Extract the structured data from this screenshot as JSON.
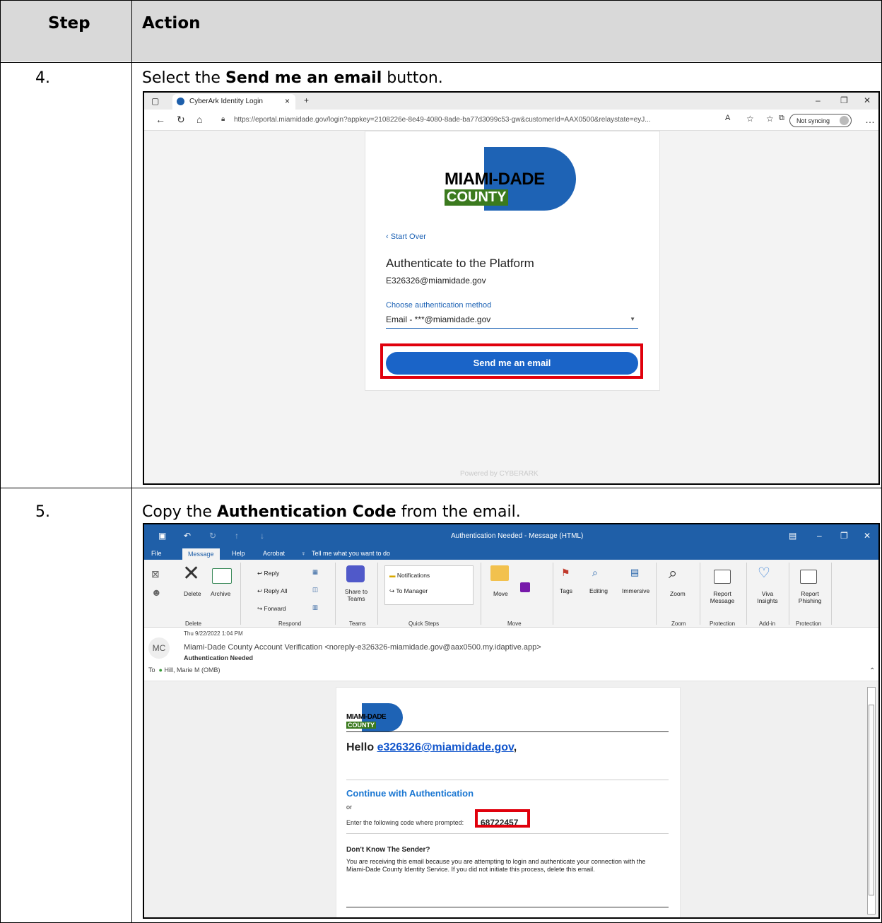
{
  "table": {
    "headers": {
      "step": "Step",
      "action": "Action"
    },
    "rows": [
      {
        "step": "4.",
        "pre": "Select the ",
        "bold": "Send me an email",
        "post": " button."
      },
      {
        "step": "5.",
        "pre": "Copy the ",
        "bold": "Authentication Code",
        "post": " from the email."
      }
    ]
  },
  "browser": {
    "tab_title": "CyberArk Identity Login",
    "url": "https://eportal.miamidade.gov/login?appkey=2108226e-8e49-4080-8ade-ba77d3099c53-gw&customerId=AAX0500&relaystate=eyJ...",
    "sync_label": "Not syncing",
    "logo_line1": "MIAMI-DADE",
    "logo_line2": "COUNTY",
    "start_over": "Start Over",
    "title": "Authenticate to the Platform",
    "username": "E326326@miamidade.gov",
    "method_label": "Choose authentication method",
    "method_value": "Email - ***@miamidade.gov",
    "send_button": "Send me an email",
    "powered_by": "Powered by  CYBERARK"
  },
  "outlook": {
    "window_title": "Authentication Needed  -  Message (HTML)",
    "menu": [
      "File",
      "Message",
      "Help",
      "Acrobat",
      "Tell me what you want to do"
    ],
    "ribbon": {
      "delete": "Delete",
      "archive": "Archive",
      "reply": "Reply",
      "reply_all": "Reply All",
      "forward": "Forward",
      "share_teams": "Share to Teams",
      "notifications": "Notifications",
      "to_manager": "To Manager",
      "move": "Move",
      "tags": "Tags",
      "editing": "Editing",
      "immersive": "Immersive",
      "zoom": "Zoom",
      "report_message": "Report Message",
      "viva": "Viva Insights",
      "report_phishing": "Report Phishing"
    },
    "groups": [
      "Delete",
      "Respond",
      "Teams",
      "Quick Steps",
      "Move",
      "Zoom",
      "Protection",
      "Add-in",
      "Protection"
    ],
    "header": {
      "avatar": "MC",
      "date": "Thu 9/22/2022 1:04 PM",
      "from": "Miami-Dade County Account Verification <noreply-e326326-miamidade.gov@aax0500.my.idaptive.app>",
      "subject": "Authentication Needed",
      "to_label": "To",
      "to": "Hill, Marie M (OMB)"
    },
    "email": {
      "logo_line1": "MIAMI-DADE",
      "logo_line2": "COUNTY",
      "hello": "Hello ",
      "hello_link": "e326326@miamidade.gov",
      "hello_end": ",",
      "continue": "Continue with Authentication",
      "or": "or",
      "code_prompt": "Enter the following code where prompted:",
      "code": "68722457",
      "sender_title": "Don't Know The Sender?",
      "sender_text": "You are receiving this email because you are attempting to login and authenticate your connection with the Miami-Dade County Identity Service. If you did not initiate this process, delete this email."
    }
  },
  "colors": {
    "header_bg": "#d9d9d9",
    "highlight": "#e0000c",
    "brand_blue": "#1e63b5",
    "brand_green": "#3b7a1e",
    "outlook_blue": "#1f5fa8"
  }
}
